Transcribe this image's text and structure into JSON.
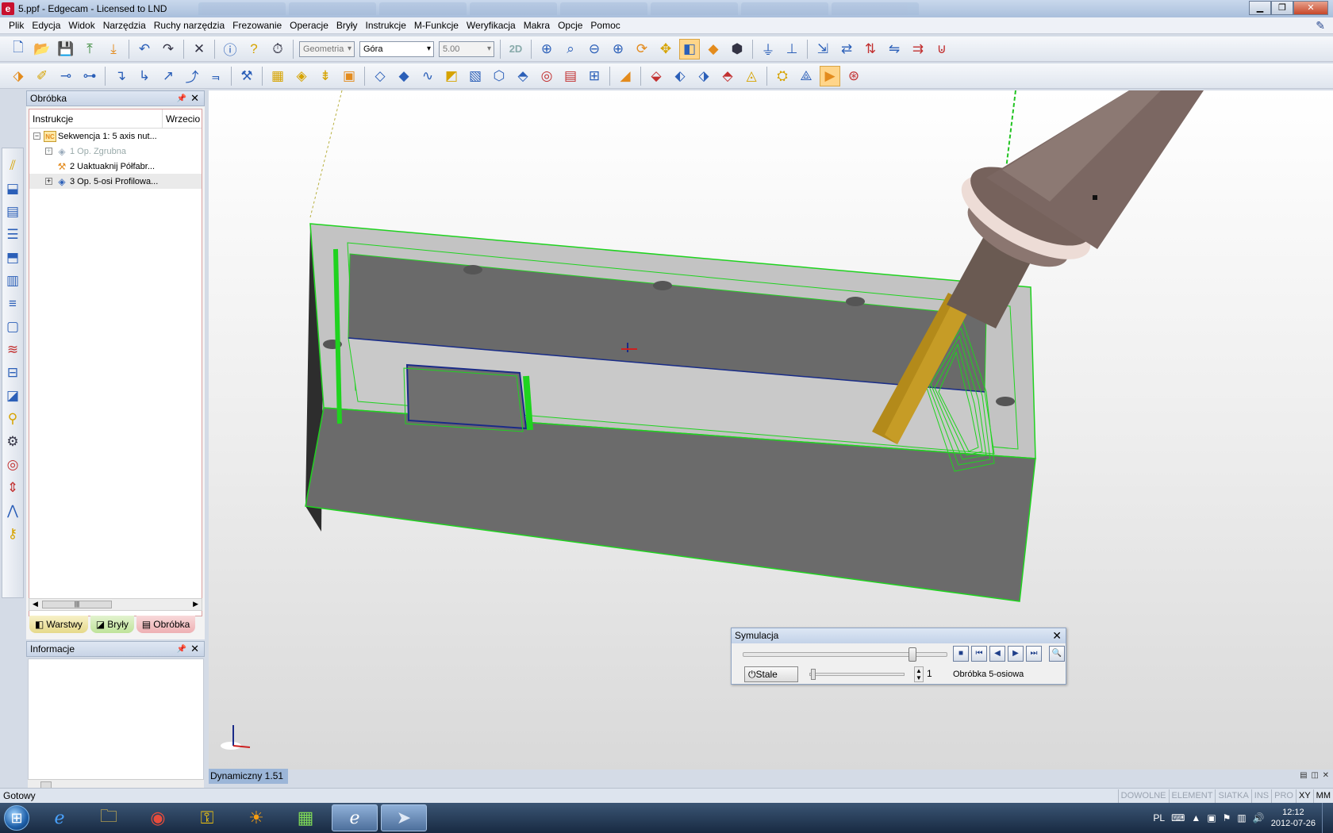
{
  "window": {
    "title": "5.ppf - Edgecam - Licensed to LND",
    "app_icon": "e",
    "buttons": [
      "minimize",
      "maximize",
      "close"
    ]
  },
  "menu": [
    "Plik",
    "Edycja",
    "Widok",
    "Narzędzia",
    "Ruchy narzędzia",
    "Frezowanie",
    "Operacje",
    "Bryły",
    "Instrukcje",
    "M-Funkcje",
    "Weryfikacja",
    "Makra",
    "Opcje",
    "Pomoc"
  ],
  "toolbar1": {
    "combo_geometry": "Geometria",
    "combo_view": "Góra",
    "combo_value": "5.00",
    "mode_2d": "2D"
  },
  "panel": {
    "title": "Obróbka",
    "col_instructions": "Instrukcje",
    "col_spindle": "Wrzecio",
    "tree": [
      {
        "label": "Sekwencja 1: 5 axis nut...",
        "icon": "nc-icon",
        "state": "normal"
      },
      {
        "label": "1 Op. Zgrubna",
        "icon": "roughing-icon",
        "state": "disabled"
      },
      {
        "label": "2 Uaktuaknij Półfabr...",
        "icon": "stock-update-icon",
        "state": "normal"
      },
      {
        "label": "3 Op. 5-osi Profilowa...",
        "icon": "five-axis-icon",
        "state": "selected"
      }
    ],
    "tabs": [
      "Warstwy",
      "Bryły",
      "Obróbka"
    ]
  },
  "info_panel": {
    "title": "Informacje"
  },
  "viewport": {
    "mode": "Dynamiczny 1.51",
    "view_controls": "▤ ◫ ✕"
  },
  "simulation": {
    "title": "Symulacja",
    "position_fraction": 0.83,
    "speed_button": "Stale",
    "step_value": "1",
    "mode": "Obróbka 5-osiowa"
  },
  "status": {
    "text": "Gotowy",
    "flags": [
      "DOWOLNE",
      "ELEMENT",
      "SIATKA",
      "INS",
      "PRO",
      "XY",
      "MM"
    ],
    "active_flags": [
      "XY",
      "MM"
    ]
  },
  "taskbar": {
    "apps": [
      "internet-explorer-icon",
      "file-explorer-icon",
      "chrome-icon",
      "key-icon",
      "sun-icon",
      "media-icon",
      "edgecam-icon",
      "arrow-app-icon"
    ],
    "language": "PL",
    "time": "12:12",
    "date": "2012-07-26"
  }
}
